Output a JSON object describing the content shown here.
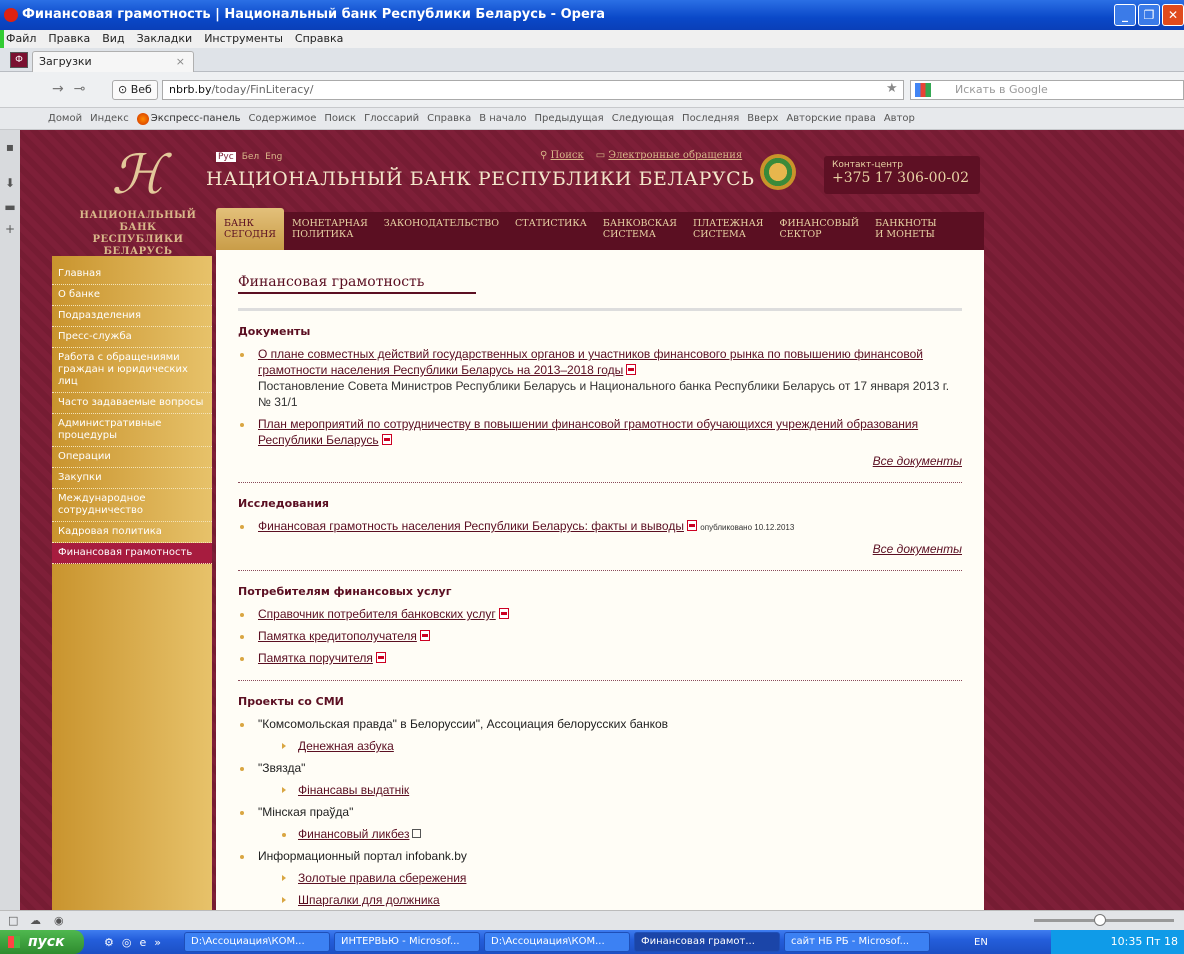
{
  "window": {
    "title": "Финансовая грамотность | Национальный банк Республики Беларусь - Opera"
  },
  "menu": [
    "Файл",
    "Правка",
    "Вид",
    "Закладки",
    "Инструменты",
    "Справка"
  ],
  "tab": {
    "label": "Загрузки",
    "close": "×"
  },
  "address": {
    "web_label": "Веб",
    "url_host": "nbrb.by",
    "url_path": "/today/FinLiteracy/",
    "search_placeholder": "Искать в Google"
  },
  "navbar": [
    "Домой",
    "Индекс",
    "Экспресс-панель",
    "Содержимое",
    "Поиск",
    "Глоссарий",
    "Справка",
    "В начало",
    "Предыдущая",
    "Следующая",
    "Последняя",
    "Вверх",
    "Авторские права",
    "Автор"
  ],
  "site": {
    "logo_caption_1": "НАЦИОНАЛЬНЫЙ БАНК",
    "logo_caption_2": "РЕСПУБЛИКИ БЕЛАРУСЬ",
    "langs": [
      "Рус",
      "Бел",
      "Eng"
    ],
    "search_link": "Поиск",
    "appeals_link": "Электронные обращения",
    "bank_name": "НАЦИОНАЛЬНЫЙ БАНК РЕСПУБЛИКИ БЕЛАРУСЬ",
    "contact_label": "Контакт-центр",
    "contact_phone": "+375 17 306-00-02",
    "topnav": [
      "БАНК\nСЕГОДНЯ",
      "МОНЕТАРНАЯ\nПОЛИТИКА",
      "ЗАКОНОДАТЕЛЬСТВО",
      "СТАТИСТИКА",
      "БАНКОВСКАЯ\nСИСТЕМА",
      "ПЛАТЕЖНАЯ\nСИСТЕМА",
      "ФИНАНСОВЫЙ\nСЕКТОР",
      "БАНКНОТЫ\nИ МОНЕТЫ"
    ],
    "sidebar": [
      "Главная",
      "О банке",
      "Подразделения",
      "Пресс-служба",
      "Работа с обращениями граждан и юридических лиц",
      "Часто задаваемые вопросы",
      "Административные процедуры",
      "Операции",
      "Закупки",
      "Международное сотрудничество",
      "Кадровая политика",
      "Финансовая грамотность"
    ]
  },
  "content": {
    "title": "Финансовая грамотность",
    "docs_heading": "Документы",
    "doc1_link": "О плане совместных действий государственных органов и участников финансового рынка по повышению финансовой грамотности населения Республики Беларусь на 2013–2018 годы",
    "doc1_sub": "Постановление Совета Министров Республики Беларусь и Национального банка Республики Беларусь от 17 января 2013 г. № 31/1",
    "doc2_link": "План мероприятий по сотрудничеству в повышении финансовой грамотности обучающихся учреждений образования Республики Беларусь",
    "all_docs": "Все документы",
    "research_heading": "Исследования",
    "research1_link": "Финансовая грамотность населения Республики Беларусь: факты и выводы",
    "research1_date": "опубликовано 10.12.2013",
    "consumers_heading": "Потребителям финансовых услуг",
    "consumer_links": [
      "Справочник потребителя банковских услуг",
      "Памятка кредитополучателя",
      "Памятка поручителя"
    ],
    "media_heading": "Проекты со СМИ",
    "media1": "\"Комсомольская правда\" в Белоруссии\", Ассоциация белорусских банков",
    "media1_link": "Денежная азбука",
    "media2": "\"Звязда\"",
    "media2_link": "Фінансавы выдатнік",
    "media3": "\"Мінская праўда\"",
    "media3_link": "Финансовый ликбез",
    "media4": "Информационный портал infobank.by",
    "media4_links": [
      "Золотые правила сбережения",
      "Шпаргалки для должника"
    ]
  },
  "taskbar": {
    "start": "пуск",
    "tasks": [
      "D:\\Ассоциация\\КОМ...",
      "ИНТЕРВЬЮ - Microsof...",
      "D:\\Ассоциация\\КОМ...",
      "Финансовая грамот...",
      "сайт НБ РБ - Microsof..."
    ],
    "lang": "EN",
    "clock": "10:35 Пт 18"
  }
}
